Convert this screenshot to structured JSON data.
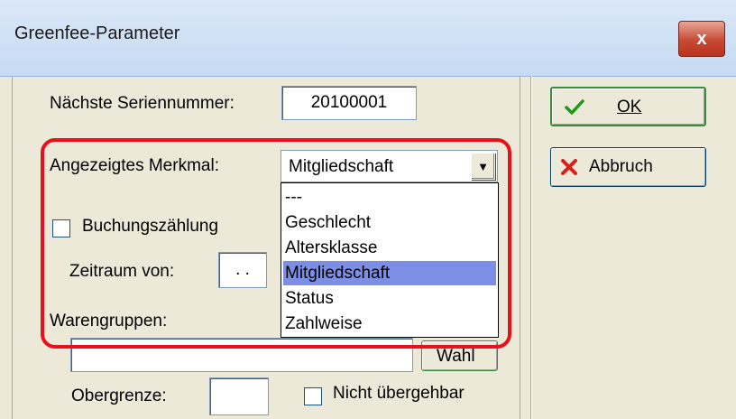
{
  "window": {
    "title": "Greenfee-Parameter",
    "close_label": "x"
  },
  "serial": {
    "label": "Nächste Seriennummer:",
    "value": "20100001"
  },
  "merkmal": {
    "label": "Angezeigtes Merkmal:",
    "value": "Mitgliedschaft",
    "options": [
      "---",
      "Geschlecht",
      "Altersklasse",
      "Mitgliedschaft",
      "Status",
      "Zahlweise"
    ],
    "selected_index": 3
  },
  "buchung": {
    "label": "Buchungszählung",
    "checked": false
  },
  "zeitraum": {
    "label": "Zeitraum von:",
    "value": ". ."
  },
  "waren": {
    "label": "Warengruppen:",
    "value": "",
    "wahl_label": "Wahl"
  },
  "obergrenze": {
    "label": "Obergrenze:",
    "value": ""
  },
  "nicht_uebergehbar": {
    "label": "Nicht übergehbar",
    "checked": false
  },
  "buttons": {
    "ok_label": "OK",
    "cancel_label": "Abbruch"
  },
  "colors": {
    "highlight": "#e8101a",
    "selection": "#7d8ee6",
    "dialog_bg": "#ece9d8"
  }
}
